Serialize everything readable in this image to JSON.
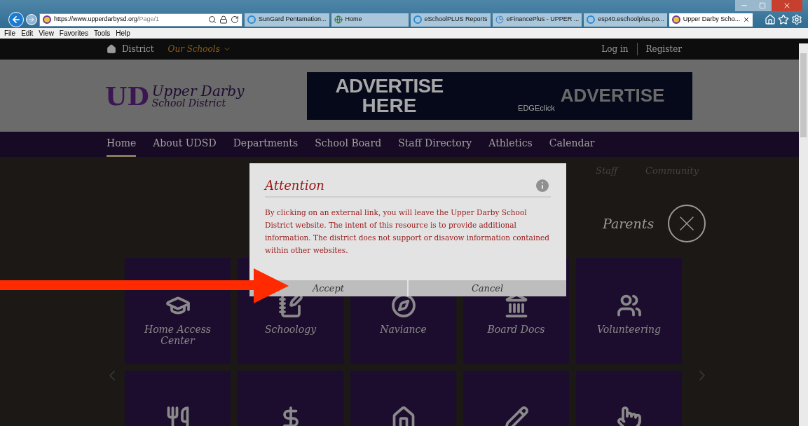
{
  "browser": {
    "address": {
      "url_host": "https://www.upperdarbysd.org",
      "url_path": "/Page/1"
    },
    "tabs": [
      {
        "label": "SunGard Pentamation...",
        "selected": false,
        "kind": "ie"
      },
      {
        "label": "Home",
        "selected": false,
        "kind": "globe"
      },
      {
        "label": "eSchoolPLUS Reports",
        "selected": false,
        "kind": "ie"
      },
      {
        "label": "eFinancePlus - UPPER ...",
        "selected": false,
        "kind": "pie"
      },
      {
        "label": "esp40.eschoolplus.po...",
        "selected": false,
        "kind": "ie"
      },
      {
        "label": "Upper Darby Scho...",
        "selected": true,
        "kind": "site"
      }
    ],
    "menu": [
      "File",
      "Edit",
      "View",
      "Favorites",
      "Tools",
      "Help"
    ]
  },
  "topbar": {
    "home_link": "District",
    "schools_menu": "Our Schools",
    "login": "Log in",
    "register": "Register"
  },
  "header": {
    "logo_mark": "UD",
    "logo_line1": "Upper Darby",
    "logo_line2": "School District",
    "ad_line1": "ADVERTISE",
    "ad_line2": "HERE",
    "ad_brand": "EDGEclick",
    "ad_repeat": "ADVERTISE"
  },
  "nav": [
    {
      "label": "Home",
      "selected": true
    },
    {
      "label": "About UDSD",
      "selected": false
    },
    {
      "label": "Departments",
      "selected": false
    },
    {
      "label": "School Board",
      "selected": false
    },
    {
      "label": "Staff Directory",
      "selected": false
    },
    {
      "label": "Athletics",
      "selected": false
    },
    {
      "label": "Calendar",
      "selected": false
    }
  ],
  "audience": [
    {
      "label": "Staff",
      "selected": false
    },
    {
      "label": "Community",
      "selected": false
    },
    {
      "label": "Parents",
      "selected": true
    }
  ],
  "tiles": [
    {
      "label": "Home Access Center",
      "kind": "grade"
    },
    {
      "label": "Schoology",
      "kind": "notebook"
    },
    {
      "label": "Naviance",
      "kind": "compass"
    },
    {
      "label": "Board Docs",
      "kind": "building"
    },
    {
      "label": "Volunteering",
      "kind": "people"
    },
    {
      "kind": "food"
    },
    {
      "kind": "dollar"
    },
    {
      "kind": "house"
    },
    {
      "kind": "pencil"
    },
    {
      "kind": "hand"
    }
  ],
  "modal": {
    "title": "Attention",
    "body": "By clicking on an external link, you will leave the Upper Darby School District website. The intent of this resource is to provide additional information. The district does not support or disavow information contained within other websites.",
    "buttons": [
      "Accept",
      "Cancel"
    ]
  }
}
